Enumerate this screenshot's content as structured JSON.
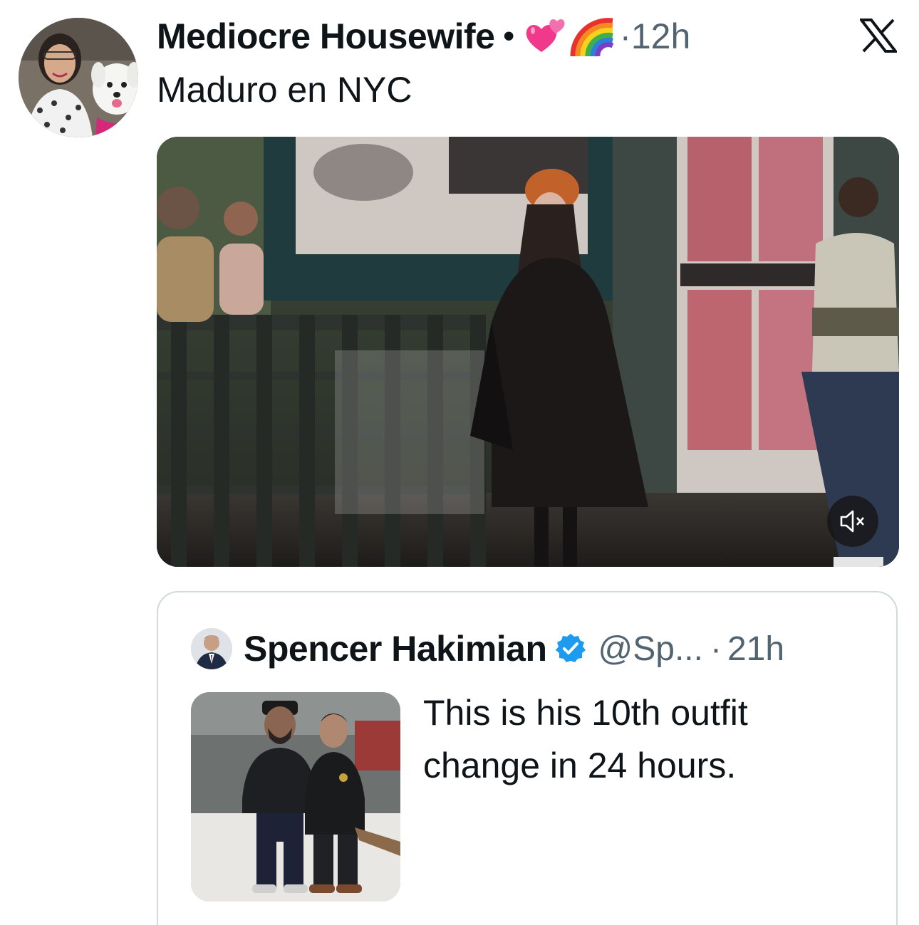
{
  "post": {
    "author_name": "Mediocre Housewife",
    "separator": "•",
    "emojis": [
      "two-hearts-emoji",
      "rainbow-emoji"
    ],
    "time_dot": "·",
    "time": "12h",
    "text": "Maduro en NYC",
    "source_icon": "x-logo-icon",
    "video": {
      "muted": true,
      "mute_icon": "speaker-muted-icon"
    }
  },
  "quote": {
    "author_name": "Spencer Hakimian",
    "verified": true,
    "handle": "@Sp...",
    "time_dot": "·",
    "time": "21h",
    "text": "This is his 10th outfit change in 24 hours."
  },
  "colors": {
    "text_primary": "#0f1419",
    "text_secondary": "#536471",
    "verified_blue": "#1d9bf0",
    "card_border": "#cfd9de"
  }
}
